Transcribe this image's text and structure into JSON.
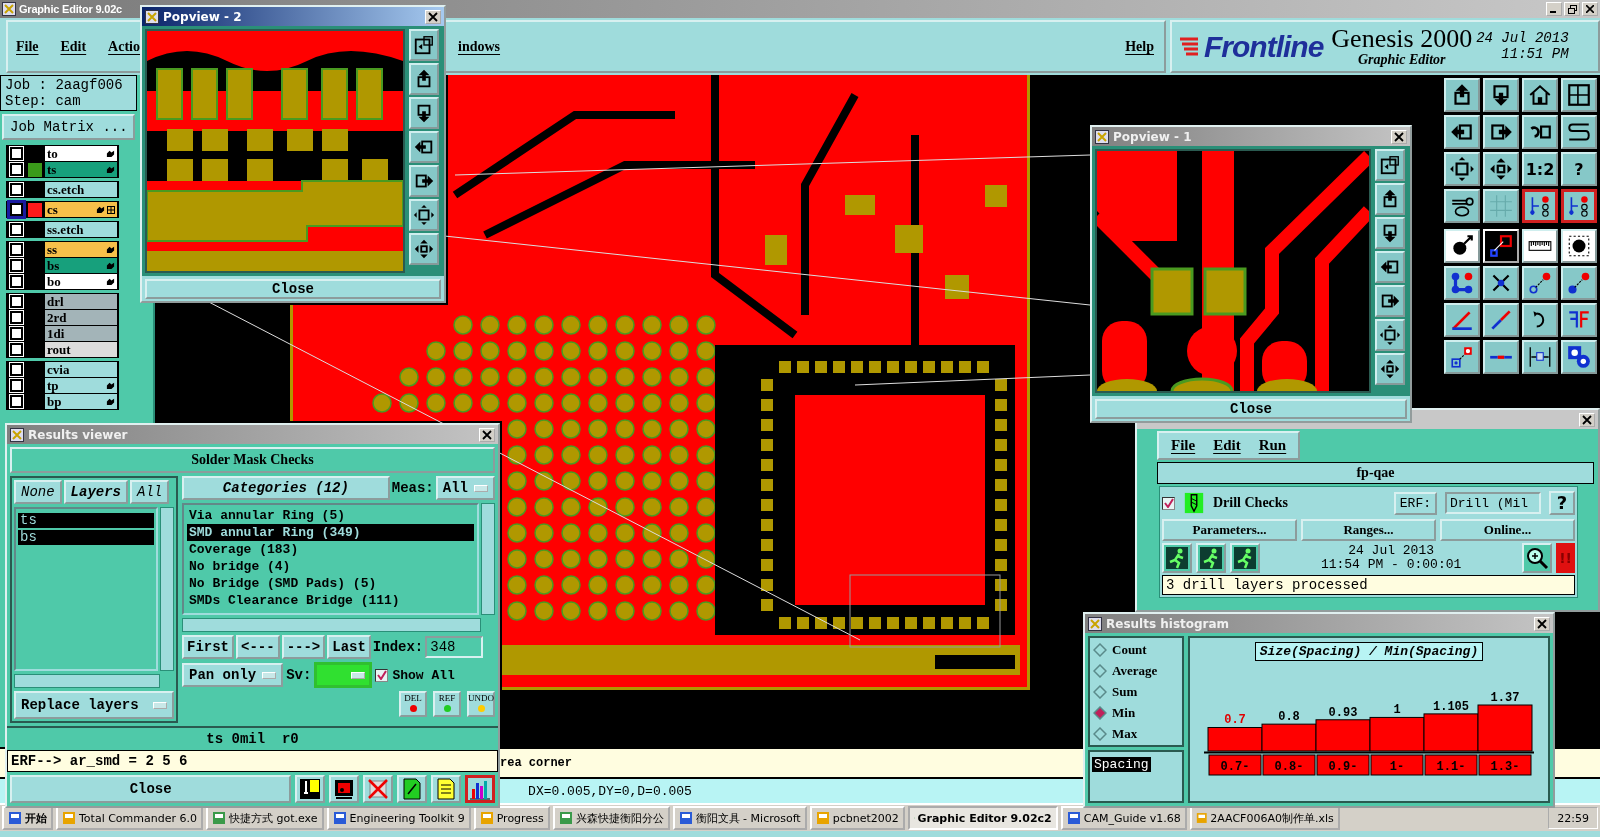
{
  "window": {
    "title": "Graphic Editor 9.02c"
  },
  "menu": {
    "left": [
      "File",
      "Edit",
      "Actio"
    ],
    "middle": [
      "indows"
    ],
    "right": [
      "Help"
    ]
  },
  "brand": {
    "logo": "Frontline",
    "product": "Genesis 2000",
    "subtitle": "Graphic Editor",
    "date": "24 Jul 2013",
    "time": "11:51 PM"
  },
  "job": {
    "job": "Job : 2aagf006",
    "step": "Step: cam",
    "matrix_button": "Job Matrix ..."
  },
  "layer_groups": [
    [
      {
        "name": "to",
        "kind": "silk_screen",
        "affected": true,
        "selected": false,
        "checked": false
      },
      {
        "name": "ts",
        "kind": "solder_mask",
        "affected": true,
        "selected": false,
        "checked": false,
        "color": "#3a9a1a"
      }
    ],
    [
      {
        "name": "cs.etch",
        "kind": "document",
        "affected": false,
        "selected": false,
        "checked": false
      }
    ],
    [
      {
        "name": "cs",
        "kind": "signal",
        "affected": true,
        "selected": true,
        "checked": false,
        "color": "#ff1a1a"
      }
    ],
    [
      {
        "name": "ss.etch",
        "kind": "document",
        "affected": false,
        "selected": false,
        "checked": false
      }
    ],
    [
      {
        "name": "ss",
        "kind": "signal",
        "affected": true,
        "selected": false,
        "checked": false
      },
      {
        "name": "bs",
        "kind": "solder_mask",
        "affected": true,
        "selected": false,
        "checked": false
      },
      {
        "name": "bo",
        "kind": "silk_screen",
        "affected": true,
        "selected": false,
        "checked": false
      }
    ],
    [
      {
        "name": "drl",
        "kind": "drill",
        "affected": false,
        "selected": false,
        "checked": false
      },
      {
        "name": "2rd",
        "kind": "drill",
        "affected": false,
        "selected": false,
        "checked": false
      },
      {
        "name": "1di",
        "kind": "drill",
        "affected": false,
        "selected": false,
        "checked": false
      },
      {
        "name": "rout",
        "kind": "rout",
        "affected": false,
        "selected": false,
        "checked": false
      }
    ],
    [
      {
        "name": "cvia",
        "kind": "document",
        "affected": false,
        "selected": false,
        "checked": false
      },
      {
        "name": "tp",
        "kind": "document",
        "affected": true,
        "selected": false,
        "checked": false
      },
      {
        "name": "bp",
        "kind": "document",
        "affected": true,
        "selected": false,
        "checked": false
      }
    ]
  ],
  "tools": [
    {
      "kind": "box-up"
    },
    {
      "kind": "box-down"
    },
    {
      "kind": "house"
    },
    {
      "kind": "window-grid"
    },
    {
      "kind": "box-left"
    },
    {
      "kind": "box-right"
    },
    {
      "kind": "undo-box"
    },
    {
      "kind": "s-curve"
    },
    {
      "kind": "fit"
    },
    {
      "kind": "pan"
    },
    {
      "kind": "label",
      "label": "1:2"
    },
    {
      "kind": "label",
      "label": "?"
    },
    {
      "kind": "wrench"
    },
    {
      "kind": "grid"
    },
    {
      "kind": "net"
    },
    {
      "kind": "net"
    },
    {
      "kind": "pad-arrow"
    },
    {
      "kind": "measure"
    },
    {
      "kind": "ruler"
    },
    {
      "kind": "pad-dotted"
    },
    {
      "kind": "nodes"
    },
    {
      "kind": "cross"
    },
    {
      "kind": "link-red"
    },
    {
      "kind": "link-blue"
    },
    {
      "kind": "angle"
    },
    {
      "kind": "diag-line"
    },
    {
      "kind": "rotate"
    },
    {
      "kind": "mirror"
    },
    {
      "kind": "square-link"
    },
    {
      "kind": "bar-line"
    },
    {
      "kind": "dimension"
    },
    {
      "kind": "blobs"
    }
  ],
  "popview_2": {
    "title": "Popview - 2",
    "close": "Close"
  },
  "popview_1": {
    "title": "Popview - 1",
    "close": "Close"
  },
  "status": {
    "message": "rea corner",
    "coordinates": "DX=0.005,DY=0,D=0.005"
  },
  "results_viewer": {
    "title": "Results viewer",
    "header": "Solder Mask Checks",
    "none_button": "None",
    "layers_label": "Layers",
    "all_button": "All",
    "layers": [
      {
        "name": "ts",
        "selected": true
      },
      {
        "name": "bs",
        "selected": true
      }
    ],
    "categories_button": "Categories (12)",
    "meas_label": "Meas:",
    "meas_value": "All",
    "categories": [
      {
        "label": "Via annular Ring (5)",
        "selected": false
      },
      {
        "label": "SMD annular Ring (349)",
        "selected": true
      },
      {
        "label": "Coverage (183)",
        "selected": false
      },
      {
        "label": "No bridge (4)",
        "selected": false
      },
      {
        "label": "No Bridge (SMD Pads) (5)",
        "selected": false
      },
      {
        "label": "SMDs Clearance Bridge (111)",
        "selected": false
      }
    ],
    "nav": [
      "First",
      "<---",
      "--->",
      "Last"
    ],
    "index_label": "Index:",
    "index_value": "348",
    "pan_mode": "Pan only",
    "sv_label": "Sv:",
    "show_all": {
      "label": "Show All",
      "checked": true
    },
    "replace_button": "Replace layers",
    "edit_buttons": [
      "DEL",
      "REF",
      "UNDO"
    ],
    "status": "ts 0mil  r0",
    "erf": "ERF--> ar_smd = 2 5 6",
    "close": "Close"
  },
  "checklist": {
    "menu": [
      "File",
      "Edit",
      "Run"
    ],
    "title": "fp-qae",
    "check": {
      "name": "Drill Checks",
      "checked": true
    },
    "erf_label": "ERF:",
    "erf_value": "Drill (Mil",
    "help": "?",
    "buttons": [
      "Parameters...",
      "Ranges...",
      "Online..."
    ],
    "date": "24 Jul 2013",
    "time": "11:54 PM - 0:00:01",
    "alert": "!!",
    "message": "3 drill layers processed"
  },
  "histogram": {
    "title": "Results histogram",
    "modes": [
      {
        "label": "Count",
        "selected": false
      },
      {
        "label": "Average",
        "selected": false
      },
      {
        "label": "Sum",
        "selected": false
      },
      {
        "label": "Min",
        "selected": true
      },
      {
        "label": "Max",
        "selected": false
      }
    ],
    "measures": [
      {
        "label": "Spacing",
        "selected": true
      }
    ],
    "chart_data": {
      "type": "bar",
      "title": "Size(Spacing) / Min(Spacing)",
      "categories": [
        "0.7-",
        "0.8-",
        "0.9-",
        "1-",
        "1.1-",
        "1.3-"
      ],
      "values": [
        0.7,
        0.8,
        0.93,
        1,
        1.105,
        1.37
      ],
      "data_labels": true
    }
  },
  "taskbar": [
    {
      "label": "开始",
      "selected": false
    },
    {
      "label": "Total Commander 6.0",
      "selected": false
    },
    {
      "label": "快捷方式 got.exe",
      "selected": false
    },
    {
      "label": "Engineering Toolkit 9",
      "selected": false
    },
    {
      "label": "Progress",
      "selected": false
    },
    {
      "label": "兴森快捷衡阳分公",
      "selected": false
    },
    {
      "label": "衡阳文具 - Microsoft",
      "selected": false
    },
    {
      "label": "pcbnet2002",
      "selected": false
    },
    {
      "label": "Graphic Editor 9.02c2",
      "selected": true
    },
    {
      "label": "CAM_Guide v1.68",
      "selected": false
    },
    {
      "label": "2AACF006A0制作单.xls",
      "selected": false
    }
  ],
  "clock": "22:59"
}
